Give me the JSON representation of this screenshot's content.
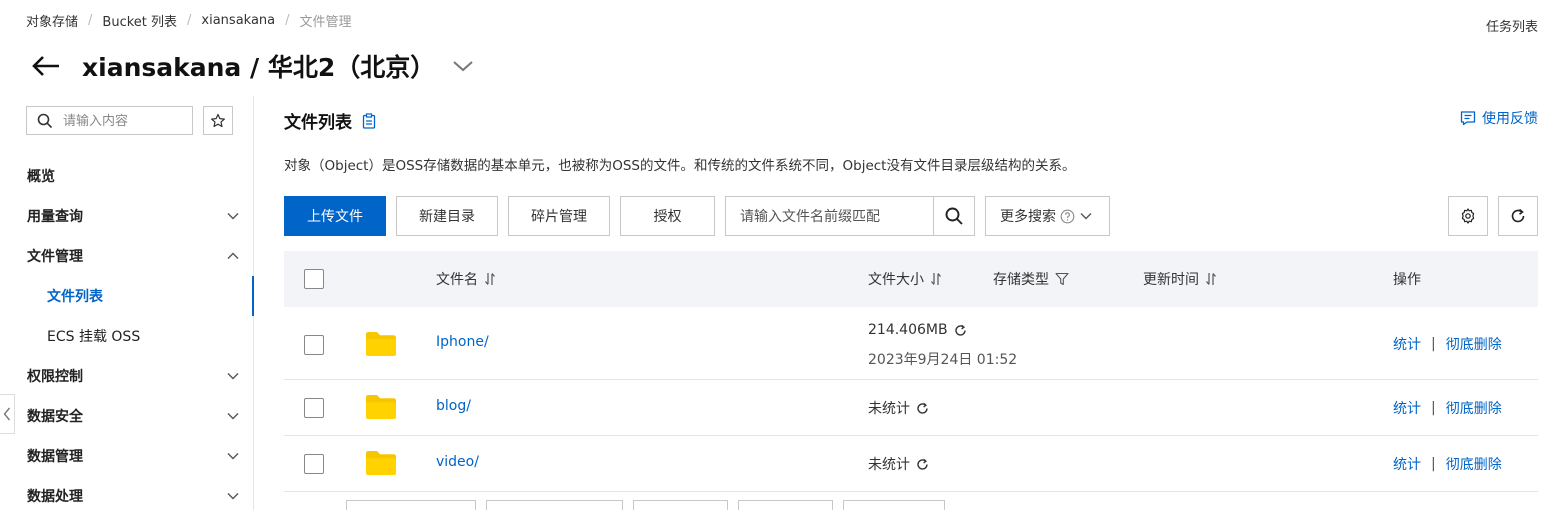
{
  "breadcrumb": [
    "对象存储",
    "Bucket 列表",
    "xiansakana",
    "文件管理"
  ],
  "task_list": "任务列表",
  "title": "xiansakana / 华北2（北京）",
  "sidebar": {
    "search_placeholder": "请输入内容",
    "items": [
      {
        "label": "概览"
      },
      {
        "label": "用量查询"
      },
      {
        "label": "文件管理"
      },
      {
        "label": "文件列表"
      },
      {
        "label": "ECS 挂载 OSS"
      },
      {
        "label": "权限控制"
      },
      {
        "label": "数据安全"
      },
      {
        "label": "数据管理"
      },
      {
        "label": "数据处理"
      }
    ]
  },
  "main": {
    "section_title": "文件列表",
    "feedback": "使用反馈",
    "description": "对象（Object）是OSS存储数据的基本单元，也被称为OSS的文件。和传统的文件系统不同，Object没有文件目录层级结构的关系。",
    "toolbar": {
      "upload": "上传文件",
      "new_dir": "新建目录",
      "fragments": "碎片管理",
      "authorize": "授权",
      "search_placeholder": "请输入文件名前缀匹配",
      "more_search": "更多搜索"
    },
    "table": {
      "headers": {
        "name": "文件名",
        "size": "文件大小",
        "storage": "存储类型",
        "updated": "更新时间",
        "ops": "操作"
      },
      "rows": [
        {
          "name": "Iphone/",
          "size": "214.406MB",
          "size_date": "2023年9月24日 01:52",
          "op1": "统计",
          "op2": "彻底删除"
        },
        {
          "name": "blog/",
          "size": "未统计",
          "op1": "统计",
          "op2": "彻底删除"
        },
        {
          "name": "video/",
          "size": "未统计",
          "op1": "统计",
          "op2": "彻底删除"
        }
      ]
    }
  },
  "colors": {
    "accent": "#0064c8",
    "folder": "#f7c600",
    "header_bg": "#f3f4f7"
  }
}
